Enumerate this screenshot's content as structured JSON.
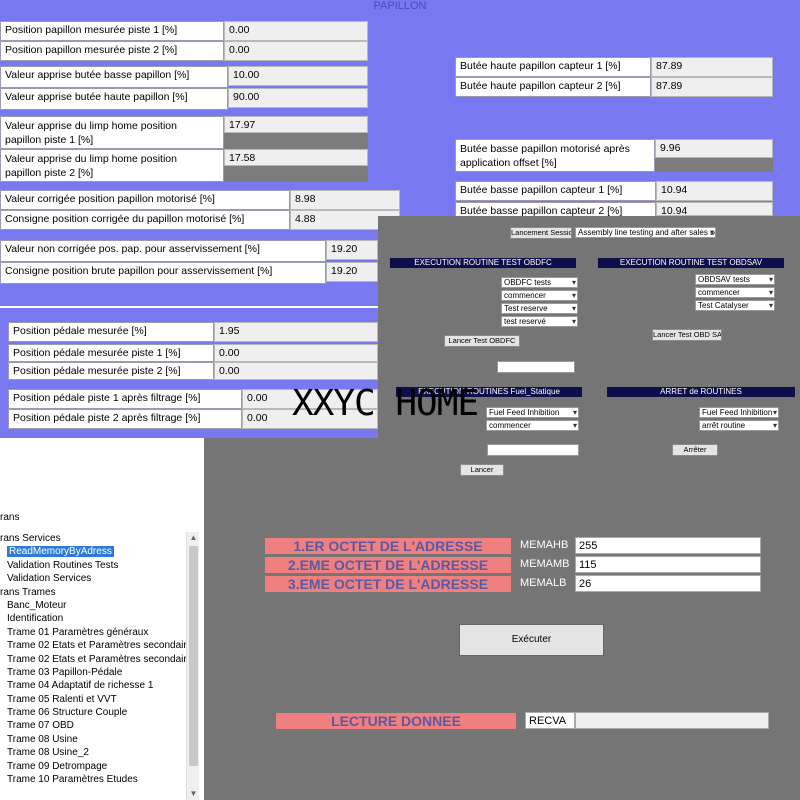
{
  "section_title": "PAPILLON",
  "rows_left": [
    {
      "label": "Position papillon mesurée piste 1 [%]",
      "value": "0.00"
    },
    {
      "label": "Position papillon mesurée piste 2 [%]",
      "value": "0.00"
    },
    {
      "label": "Valeur apprise butée basse papillon [%]",
      "value": "10.00"
    },
    {
      "label": "Valeur apprise butée haute papillon [%]",
      "value": "90.00"
    },
    {
      "label_l1": "Valeur apprise du limp home position",
      "label_l2": "papillon piste 1 [%]",
      "value": "17.97"
    },
    {
      "label_l1": "Valeur apprise du limp home position",
      "label_l2": "papillon piste 2 [%]",
      "value": "17.58"
    },
    {
      "label": "Valeur corrigée position papillon motorisé [%]",
      "value": "8.98"
    },
    {
      "label": "Consigne position corrigée du papillon motorisé [%]",
      "value": "4.88"
    },
    {
      "label": "Valeur non corrigée pos. pap. pour asservissement [%]",
      "value": "19.20"
    },
    {
      "label": "Consigne position brute papillon pour asservissement [%]",
      "value": "19.20"
    }
  ],
  "rows_right": [
    {
      "label": "Butée haute papillon capteur 1 [%]",
      "value": "87.89"
    },
    {
      "label": "Butée haute papillon capteur 2 [%]",
      "value": "87.89"
    },
    {
      "label_l1": "Butée basse papillon motorisé après",
      "label_l2": "application offset [%]",
      "value": "9.96"
    },
    {
      "label": "Butée basse papillon capteur 1 [%]",
      "value": "10.94"
    },
    {
      "label": "Butée basse papillon capteur 2 [%]",
      "value": "10.94"
    }
  ],
  "pedal_rows": [
    {
      "label": "Position pédale mesurée [%]",
      "value": "1.95"
    },
    {
      "label": "Position pédale mesurée piste 1 [%]",
      "value": "0.00"
    },
    {
      "label": "Position pédale mesurée piste 2 [%]",
      "value": "0.00"
    },
    {
      "label": "Position pédale piste 1 après filtrage [%]",
      "value": "0.00"
    },
    {
      "label": "Position pédale piste 2 après filtrage [%]",
      "value": "0.00"
    }
  ],
  "overlay": {
    "session_button": "Lancement Session",
    "session_select": "Assembly line testing and after sales sess",
    "obdfc_header": "EXECUTION ROUTINE TEST OBDFC",
    "obdsav_header": "EXECUTION ROUTINE TEST OBDSAV",
    "obdfc_selects": [
      "OBDFC tests",
      "commencer",
      "Test reserve",
      "test reservé"
    ],
    "obdsav_selects": [
      "OBDSAV tests",
      "commencer",
      "Test Catalyser"
    ],
    "obdfc_button": "Lancer Test OBDFC",
    "obdsav_button": "Lancer Test OBD SA",
    "fuel_header": "EXECUTION ROUTINES Fuel_Statique",
    "stop_header": "ARRET de ROUTINES",
    "fuel_selects": [
      "Fuel Feed Inhibition",
      "commencer"
    ],
    "stop_selects": [
      "Fuel Feed Inhibition",
      "arrêt routine"
    ],
    "fuel_button": "Lancer",
    "stop_button": "Arrêter"
  },
  "tree": {
    "frame_label": "rans",
    "items": [
      {
        "text": "rans Services",
        "indent": 0
      },
      {
        "text": "ReadMemoryByAdress",
        "indent": 1,
        "selected": true
      },
      {
        "text": "Validation Routines Tests",
        "indent": 1
      },
      {
        "text": "Validation Services",
        "indent": 1
      },
      {
        "text": "rans Trames",
        "indent": 0
      },
      {
        "text": "Banc_Moteur",
        "indent": 1
      },
      {
        "text": "Identification",
        "indent": 1
      },
      {
        "text": "Trame 01 Paramètres généraux",
        "indent": 1
      },
      {
        "text": "Trame 02 Etats et Paramètres secondaires",
        "indent": 1
      },
      {
        "text": "Trame 02 Etats et Paramètres secondaires _2",
        "indent": 1
      },
      {
        "text": "Trame 03 Papillon-Pédale",
        "indent": 1
      },
      {
        "text": "Trame 04 Adaptatif de richesse 1",
        "indent": 1
      },
      {
        "text": "Trame 05 Ralenti et VVT",
        "indent": 1
      },
      {
        "text": "Trame 06 Structure Couple",
        "indent": 1
      },
      {
        "text": "Trame 07 OBD",
        "indent": 1
      },
      {
        "text": "Trame 08 Usine",
        "indent": 1
      },
      {
        "text": "Trame 08 Usine_2",
        "indent": 1
      },
      {
        "text": "Trame 09 Detrompage",
        "indent": 1
      },
      {
        "text": "Trame 10 Paramètres Etudes",
        "indent": 1
      }
    ]
  },
  "memory": {
    "rows": [
      {
        "title": "1.ER OCTET DE L'ADRESSE",
        "name": "MEMAHB",
        "value": "255"
      },
      {
        "title": "2.EME OCTET DE L'ADRESSE",
        "name": "MEMAMB",
        "value": "115"
      },
      {
        "title": "3.EME OCTET DE L'ADRESSE",
        "name": "MEMALB",
        "value": "26"
      }
    ],
    "execute_label": "Exécuter",
    "read_title": "LECTURE DONNEE",
    "read_name": "RECVA",
    "read_value": ""
  },
  "watermark": "XXYC HOME"
}
